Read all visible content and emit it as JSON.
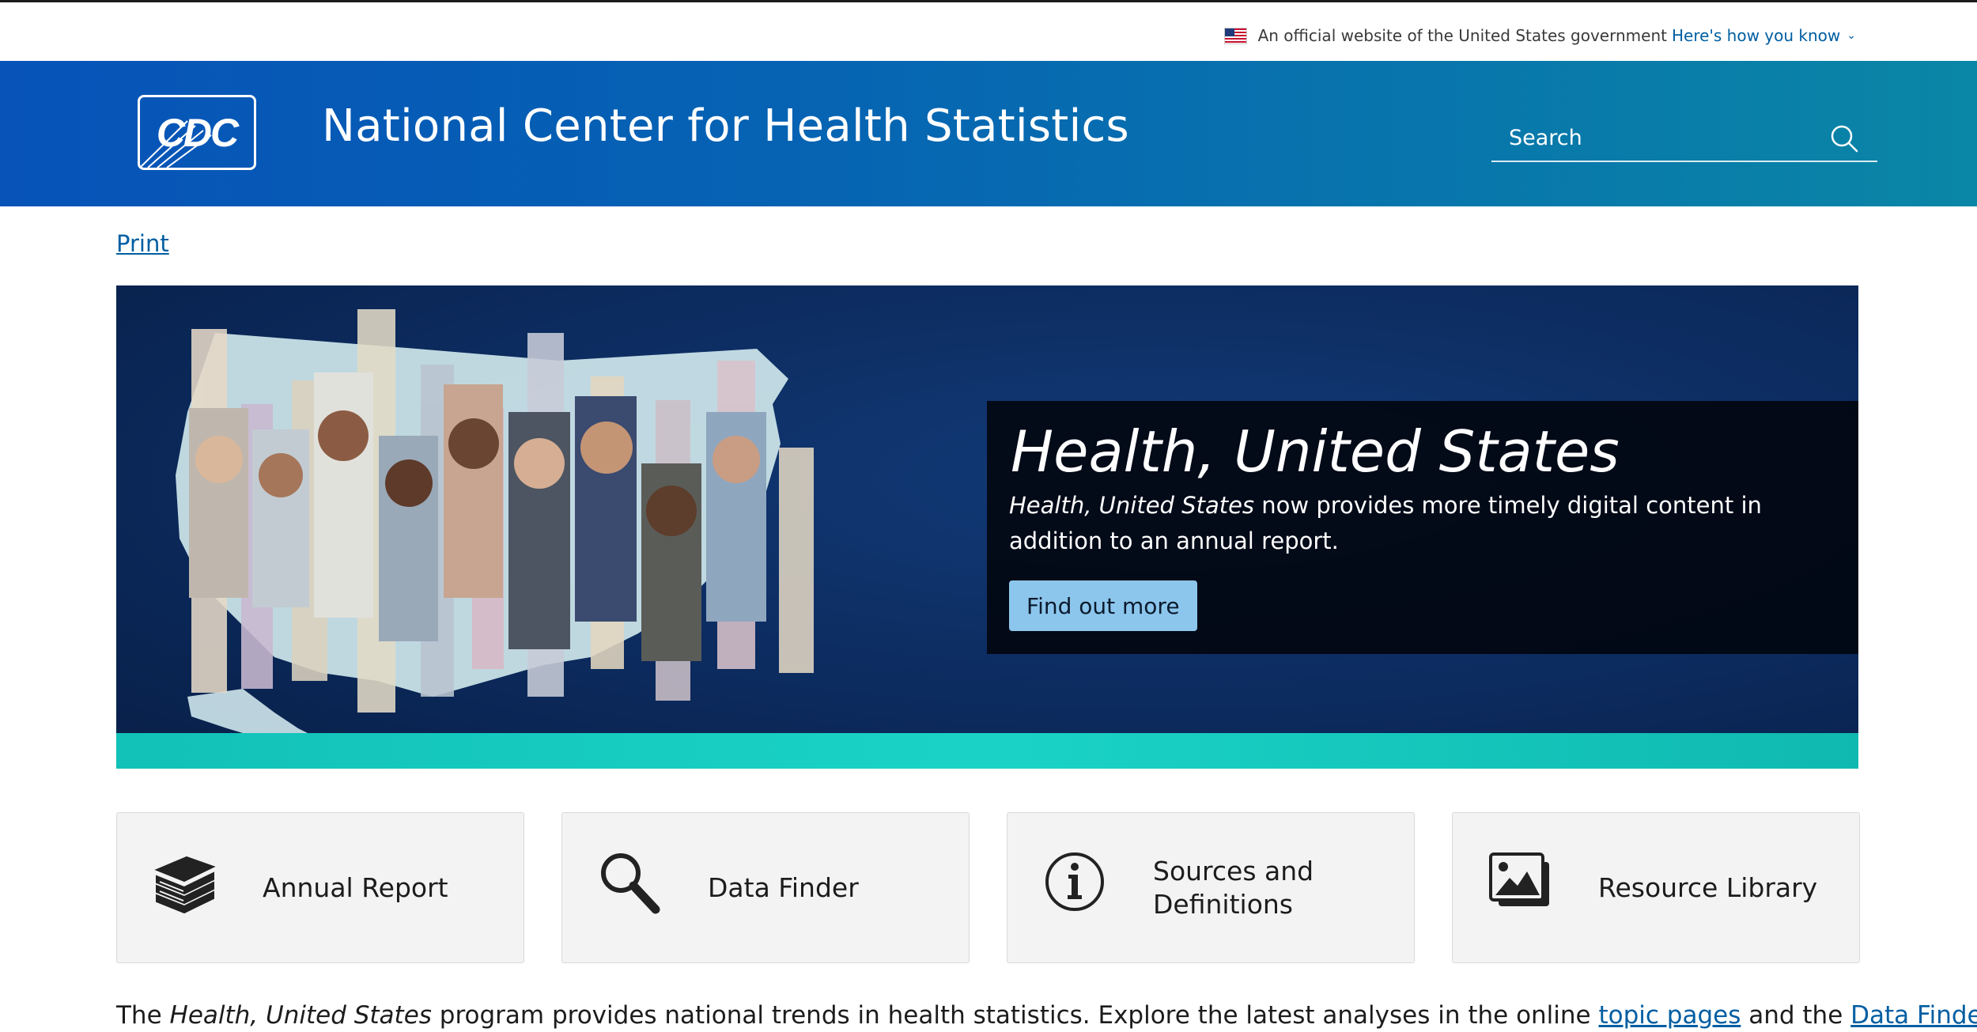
{
  "gov_banner": {
    "text": "An official website of the United States government",
    "link": "Here's how you know"
  },
  "header": {
    "logo_text": "CDC",
    "title": "National Center for Health Statistics",
    "search_placeholder": "Search"
  },
  "print_link": "Print",
  "hero": {
    "title": "Health, United States",
    "desc_italic": "Health, United States",
    "desc_rest": " now provides more timely digital content in addition to an annual report.",
    "button": "Find out more"
  },
  "cards": [
    {
      "label": "Annual Report",
      "icon": "book-stack-icon"
    },
    {
      "label": "Data Finder",
      "icon": "magnifier-icon"
    },
    {
      "label": "Sources and Definitions",
      "icon": "info-circle-icon"
    },
    {
      "label": "Resource Library",
      "icon": "image-gallery-icon"
    }
  ],
  "intro": {
    "prefix": "The ",
    "italic": "Health, United States",
    "middle": " program provides national trends in health statistics. Explore the latest analyses in the online ",
    "link1": "topic pages",
    "and": " and the ",
    "link2": "Data Finder",
    "suffix": "."
  },
  "colors": {
    "header_start": "#0753b8",
    "header_end": "#0a86a6",
    "link": "#005ea2",
    "hero_bg": "#0c2b5e",
    "hero_teal": "#1ad3c6",
    "button_bg": "#8cc6ec",
    "card_bg": "#f3f3f3"
  }
}
